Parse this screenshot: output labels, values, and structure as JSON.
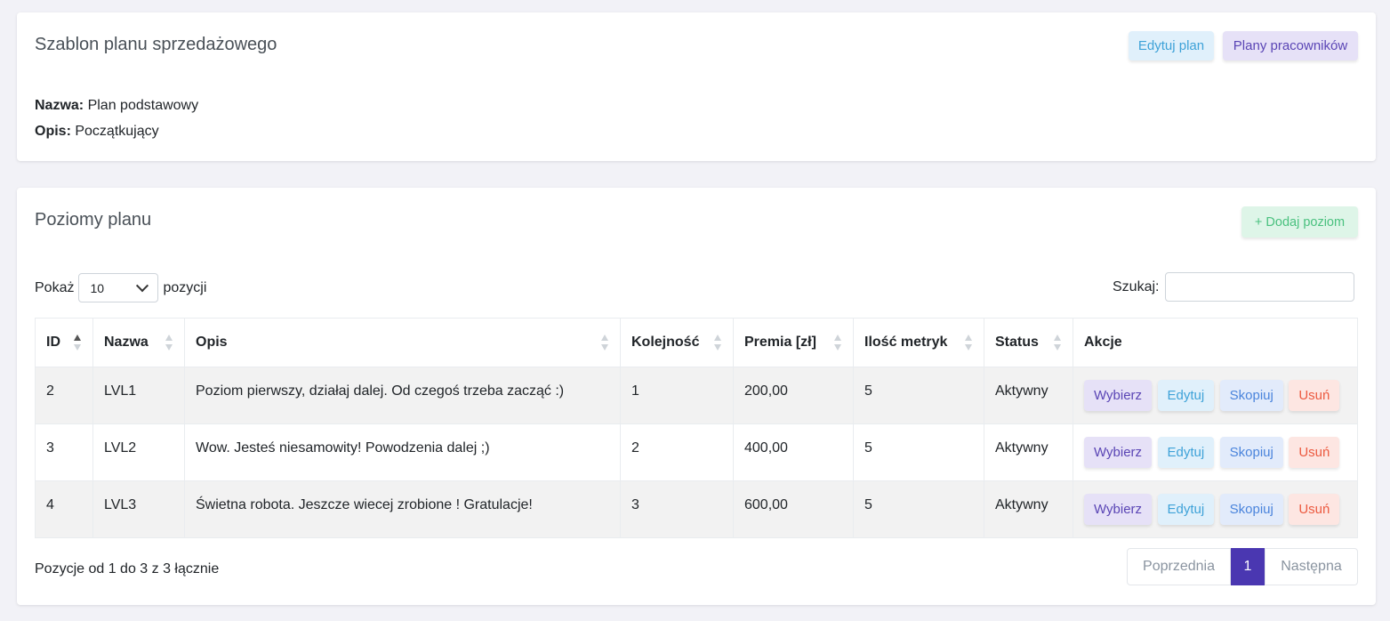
{
  "template_card": {
    "title": "Szablon planu sprzedażowego",
    "edit_plan_label": "Edytuj plan",
    "employee_plans_label": "Plany pracowników",
    "name_label": "Nazwa:",
    "name_value": "Plan podstawowy",
    "desc_label": "Opis:",
    "desc_value": "Początkujący"
  },
  "levels_card": {
    "title": "Poziomy planu",
    "add_level_label": "+ Dodaj poziom",
    "show_label": "Pokaż",
    "page_size": "10",
    "entries_label": "pozycji",
    "search_label": "Szukaj:",
    "search_value": "",
    "columns": [
      "ID",
      "Nazwa",
      "Opis",
      "Kolejność",
      "Premia [zł]",
      "Ilość metryk",
      "Status",
      "Akcje"
    ],
    "rows": [
      {
        "id": "2",
        "name": "LVL1",
        "desc": "Poziom pierwszy, działaj dalej. Od czegoś trzeba zacząć :)",
        "order": "1",
        "bonus": "200,00",
        "metrics": "5",
        "status": "Aktywny"
      },
      {
        "id": "3",
        "name": "LVL2",
        "desc": "Wow. Jesteś niesamowity! Powodzenia dalej ;)",
        "order": "2",
        "bonus": "400,00",
        "metrics": "5",
        "status": "Aktywny"
      },
      {
        "id": "4",
        "name": "LVL3",
        "desc": "Świetna robota. Jeszcze wiecej zrobione ! Gratulacje!",
        "order": "3",
        "bonus": "600,00",
        "metrics": "5",
        "status": "Aktywny"
      }
    ],
    "actions": {
      "select": "Wybierz",
      "edit": "Edytuj",
      "copy": "Skopiuj",
      "delete": "Usuń"
    },
    "info": "Pozycje od 1 do 3 z 3 łącznie",
    "pagination": {
      "prev": "Poprzednia",
      "current": "1",
      "next": "Następna"
    }
  },
  "colors": {
    "accent": "#4a37b1",
    "info": "#3ea2d8",
    "success": "#4ac17f",
    "danger": "#ec5a40",
    "background": "#f2f2f7"
  }
}
